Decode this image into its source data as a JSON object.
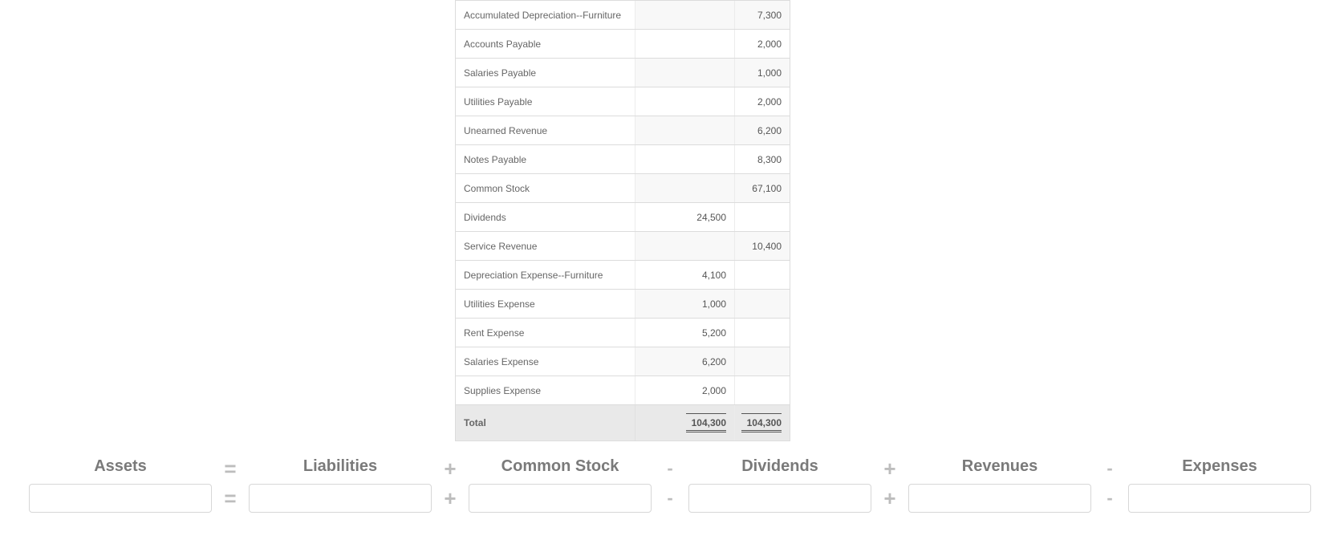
{
  "trial_balance": {
    "rows": [
      {
        "name": "Accumulated Depreciation--Furniture",
        "debit": "",
        "credit": "7,300"
      },
      {
        "name": "Accounts Payable",
        "debit": "",
        "credit": "2,000"
      },
      {
        "name": "Salaries Payable",
        "debit": "",
        "credit": "1,000"
      },
      {
        "name": "Utilities Payable",
        "debit": "",
        "credit": "2,000"
      },
      {
        "name": "Unearned Revenue",
        "debit": "",
        "credit": "6,200"
      },
      {
        "name": "Notes Payable",
        "debit": "",
        "credit": "8,300"
      },
      {
        "name": "Common Stock",
        "debit": "",
        "credit": "67,100"
      },
      {
        "name": "Dividends",
        "debit": "24,500",
        "credit": ""
      },
      {
        "name": "Service Revenue",
        "debit": "",
        "credit": "10,400"
      },
      {
        "name": "Depreciation Expense--Furniture",
        "debit": "4,100",
        "credit": ""
      },
      {
        "name": "Utilities Expense",
        "debit": "1,000",
        "credit": ""
      },
      {
        "name": "Rent Expense",
        "debit": "5,200",
        "credit": ""
      },
      {
        "name": "Salaries Expense",
        "debit": "6,200",
        "credit": ""
      },
      {
        "name": "Supplies Expense",
        "debit": "2,000",
        "credit": ""
      }
    ],
    "total_label": "Total",
    "total_debit": "104,300",
    "total_credit": "104,300"
  },
  "equation": {
    "terms": [
      {
        "label": "Assets",
        "value": ""
      },
      {
        "label": "Liabilities",
        "value": ""
      },
      {
        "label": "Common Stock",
        "value": ""
      },
      {
        "label": "Dividends",
        "value": ""
      },
      {
        "label": "Revenues",
        "value": ""
      },
      {
        "label": "Expenses",
        "value": ""
      }
    ],
    "ops": [
      "=",
      "+",
      "-",
      "+",
      "-"
    ]
  }
}
